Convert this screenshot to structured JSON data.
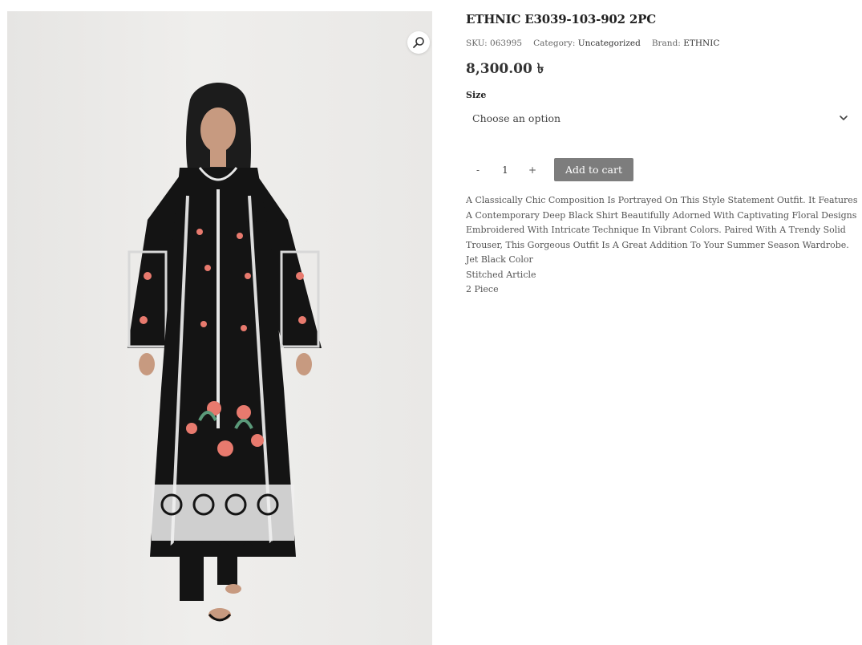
{
  "product": {
    "title": "ETHNIC E3039-103-902 2PC",
    "sku_label": "SKU:",
    "sku": "063995",
    "category_label": "Category:",
    "category": "Uncategorized",
    "brand_label": "Brand:",
    "brand": "ETHNIC",
    "price": "8,300.00 ৳"
  },
  "variation": {
    "label": "Size",
    "selected": "Choose an option"
  },
  "cart": {
    "minus": "-",
    "quantity": "1",
    "plus": "+",
    "add_label": "Add to cart"
  },
  "description": {
    "text": "A Classically Chic Composition Is Portrayed On This Style Statement Outfit. It Features A Contemporary Deep Black Shirt Beautifully Adorned With Captivating Floral Designs Embroidered With Intricate Technique In Vibrant Colors. Paired With A Trendy Solid Trouser, This Gorgeous Outfit Is A Great Addition To Your Summer Season Wardrobe.",
    "details": [
      "Jet Black Color",
      "Stitched Article",
      "2 Piece"
    ]
  },
  "icons": {
    "zoom": "magnifier-icon",
    "dropdown": "chevron-down-icon"
  },
  "colors": {
    "button_bg": "#7d7d7d",
    "dress": "#141414",
    "embroidery": "#e87a6e"
  }
}
